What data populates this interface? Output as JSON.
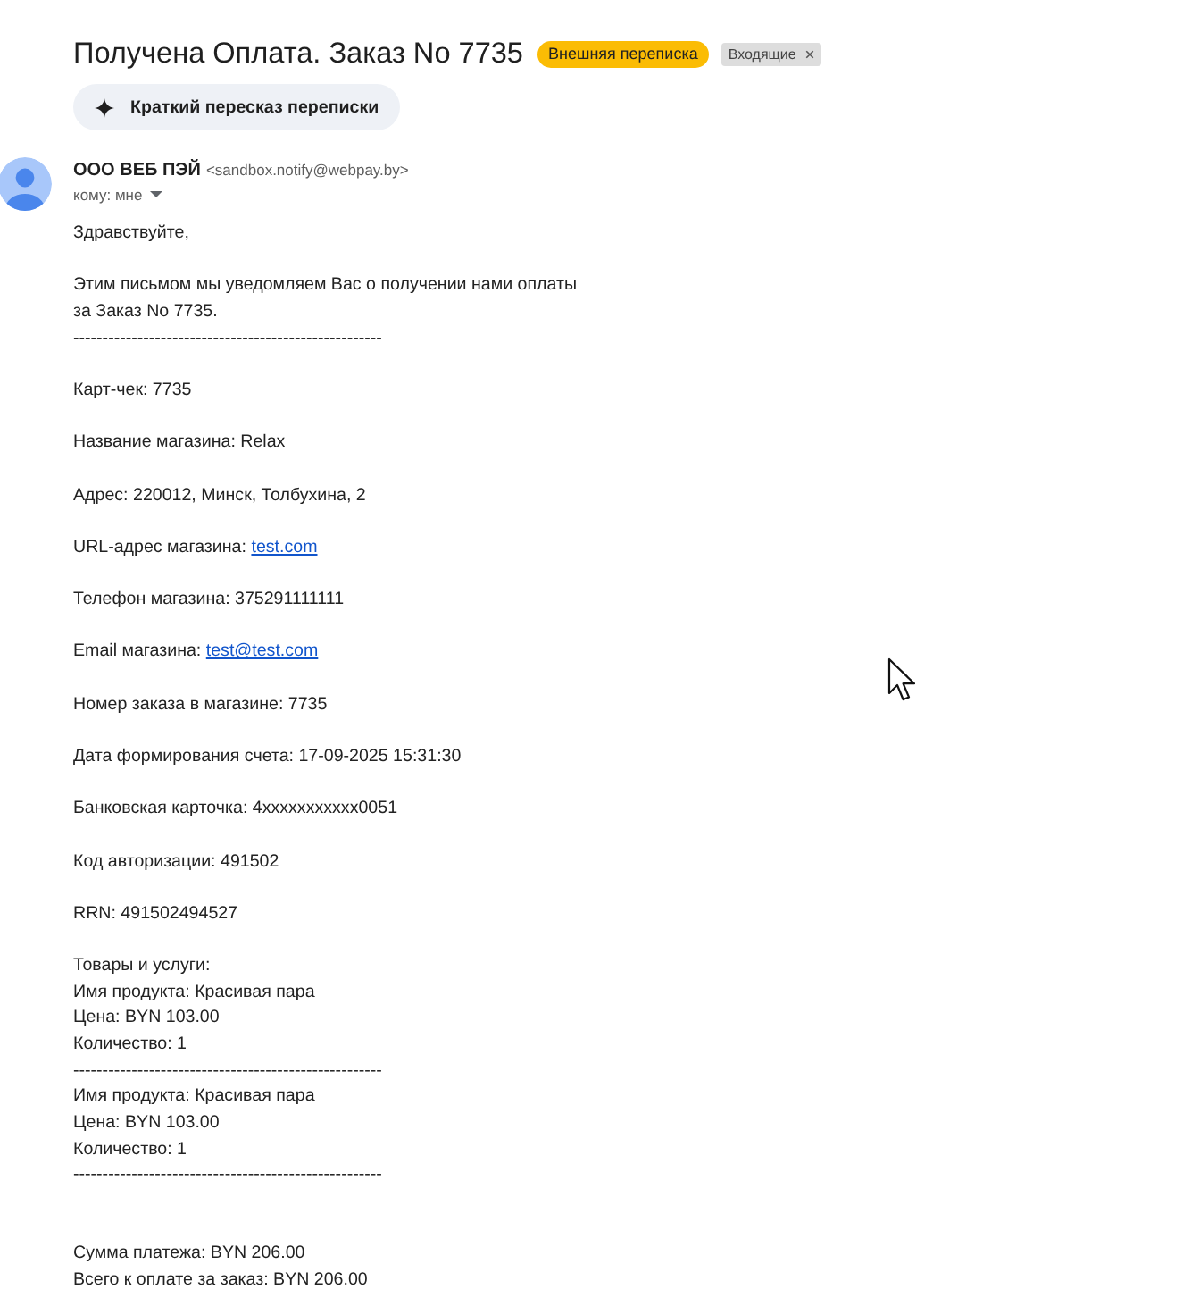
{
  "message": {
    "subject": "Получена Оплата. Заказ No 7735",
    "labels": [
      {
        "kind": "category",
        "text": "Внешняя переписка",
        "color": "#fbbc04",
        "removable": false
      },
      {
        "kind": "folder",
        "text": "Входящие",
        "color": "#dddddd",
        "removable": true
      }
    ]
  },
  "summary_button": {
    "label": "Краткий пересказ переписки"
  },
  "sender": {
    "name": "ООО ВЕБ ПЭЙ",
    "email": "<sandbox.notify@webpay.by>",
    "recipient": "кому: мне"
  },
  "body": [
    {
      "kind": "paragraph",
      "lines": [
        {
          "kind": "text",
          "text": "Здравствуйте,"
        }
      ]
    },
    {
      "kind": "paragraph",
      "lines": [
        {
          "kind": "text",
          "text": "Этим письмом мы уведомляем Вас о получении нами оплаты за Заказ No 7735."
        },
        {
          "kind": "separator",
          "text": "-----------------------------------------------------"
        }
      ]
    },
    {
      "kind": "paragraph",
      "lines": [
        {
          "kind": "text",
          "text": "Карт-чек: 7735"
        }
      ]
    },
    {
      "kind": "paragraph",
      "lines": [
        {
          "kind": "text",
          "text": "Название магазина: Relax"
        }
      ]
    },
    {
      "kind": "paragraph",
      "lines": [
        {
          "kind": "text",
          "text": "Адрес: 220012, Минск, Толбухина, 2"
        }
      ]
    },
    {
      "kind": "paragraph",
      "lines": [
        {
          "kind": "link",
          "text": "URL-адрес магазина:",
          "link": "test.com"
        }
      ]
    },
    {
      "kind": "paragraph",
      "lines": [
        {
          "kind": "text",
          "text": "Телефон магазина: 375291111111"
        }
      ]
    },
    {
      "kind": "paragraph",
      "lines": [
        {
          "kind": "link",
          "text": "Email магазина:",
          "link": "test@test.com"
        }
      ]
    },
    {
      "kind": "paragraph",
      "lines": [
        {
          "kind": "text",
          "text": "Номер заказа в магазине: 7735"
        }
      ]
    },
    {
      "kind": "paragraph",
      "lines": [
        {
          "kind": "text",
          "text": "Дата формирования счета: 17-09-2025 15:31:30"
        }
      ]
    },
    {
      "kind": "paragraph",
      "lines": [
        {
          "kind": "text",
          "text": "Банковская карточка: 4xxxxxxxxxxx0051"
        }
      ]
    },
    {
      "kind": "paragraph",
      "lines": [
        {
          "kind": "text",
          "text": "Код авторизации: 491502"
        }
      ]
    },
    {
      "kind": "paragraph",
      "lines": [
        {
          "kind": "text",
          "text": "RRN: 491502494527"
        }
      ]
    },
    {
      "kind": "paragraph",
      "lines": [
        {
          "kind": "text",
          "text": "Товары и услуги:"
        },
        {
          "kind": "text",
          "text": "Имя продукта: Красивая пара"
        },
        {
          "kind": "text",
          "text": "Цена: BYN 103.00"
        },
        {
          "kind": "text",
          "text": "Количество: 1"
        },
        {
          "kind": "separator",
          "text": "-----------------------------------------------------"
        },
        {
          "kind": "text",
          "text": "Имя продукта: Красивая пара"
        },
        {
          "kind": "text",
          "text": "Цена: BYN 103.00"
        },
        {
          "kind": "text",
          "text": "Количество: 1"
        },
        {
          "kind": "separator",
          "text": "-----------------------------------------------------"
        }
      ]
    },
    {
      "kind": "totals",
      "lines": [
        {
          "kind": "text",
          "text": "Сумма платежа: BYN 206.00"
        },
        {
          "kind": "text",
          "text": "Всего к оплате за заказ: BYN 206.00"
        }
      ]
    }
  ]
}
